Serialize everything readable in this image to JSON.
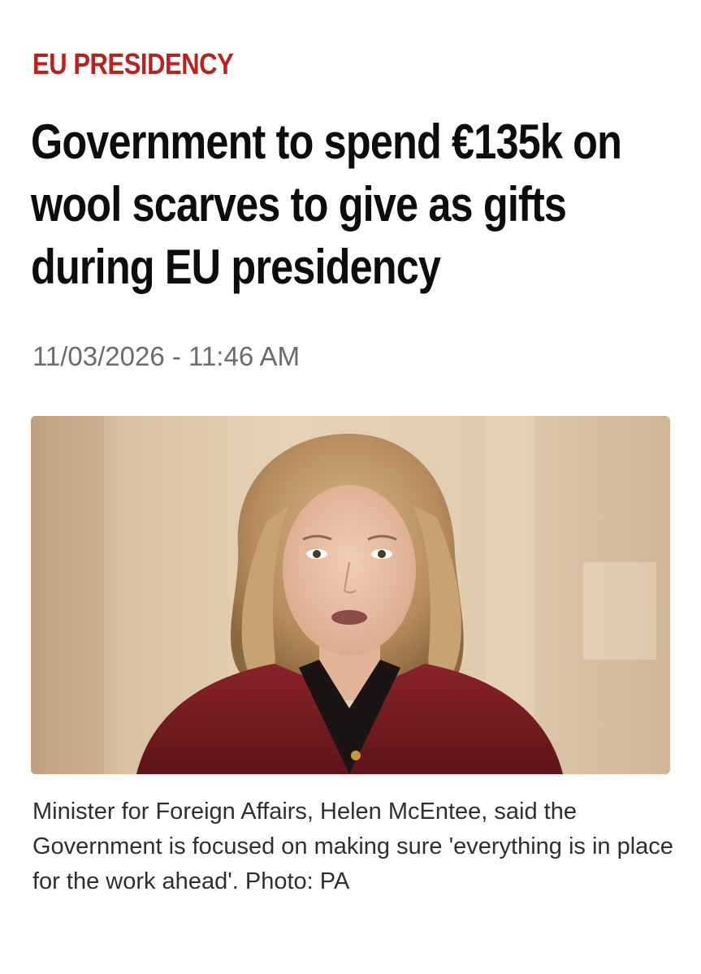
{
  "article": {
    "category": "EU PRESIDENCY",
    "headline": "Government to spend €135k on wool scarves to give as gifts during EU presidency",
    "timestamp": "11/03/2026 - 11:46 AM",
    "photo": {
      "subject": "photo"
    },
    "caption": "Minister for Foreign Affairs, Helen McEntee, said the Government is focused on making sure 'everything is in place for the work ahead'. Photo: PA"
  },
  "colors": {
    "category": "#b8231f",
    "headline": "#0d0d0d",
    "timestamp": "#6b6b6b",
    "caption": "#2f2f2f",
    "jacket": "#7a1f24"
  }
}
